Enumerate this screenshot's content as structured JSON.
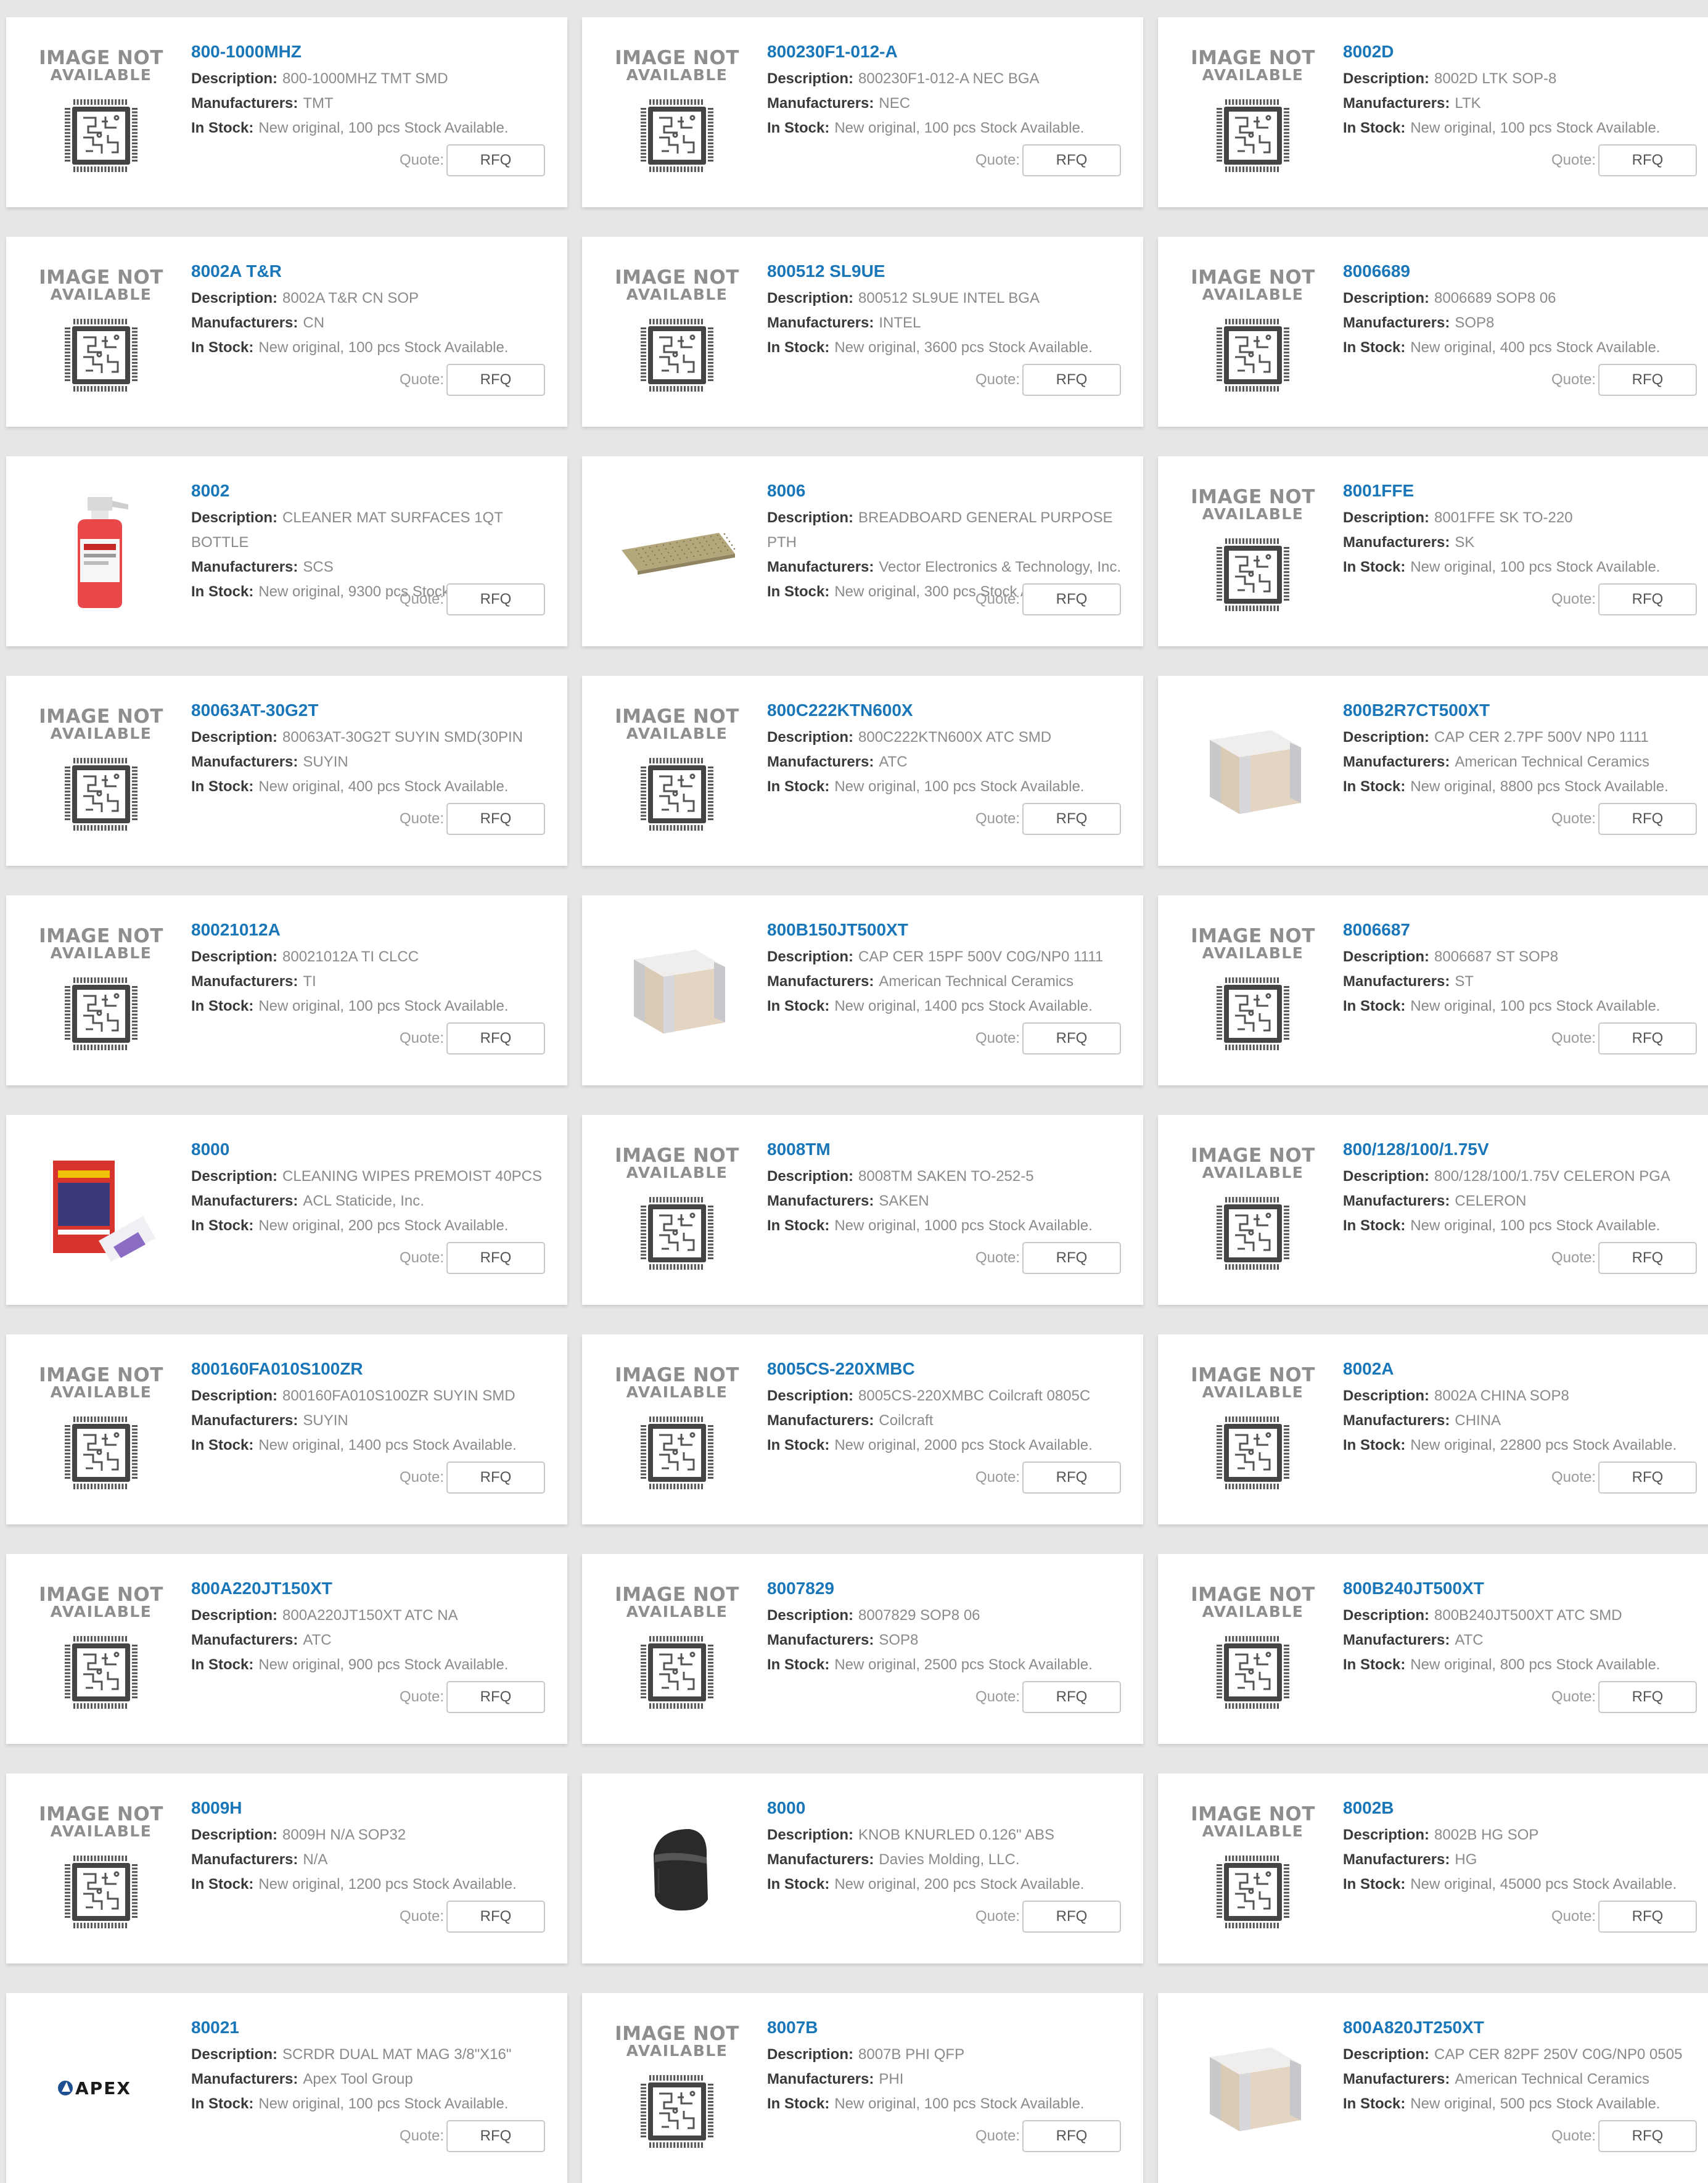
{
  "labels": {
    "description": "Description:",
    "manufacturers": "Manufacturers:",
    "in_stock": "In Stock:",
    "quote": "Quote:",
    "rfq": "RFQ",
    "image_na_line1": "IMAGE NOT",
    "image_na_line2": "AVAILABLE"
  },
  "colors": {
    "link": "#1976b8",
    "background": "#e6e6e6",
    "card": "#ffffff"
  },
  "products": [
    {
      "pn": "800-1000MHZ",
      "desc": "800-1000MHZ TMT SMD",
      "mfr": "TMT",
      "stock": "New original, 100 pcs Stock Available.",
      "image": "image-not-available"
    },
    {
      "pn": "800230F1-012-A",
      "desc": "800230F1-012-A NEC BGA",
      "mfr": "NEC",
      "stock": "New original, 100 pcs Stock Available.",
      "image": "image-not-available"
    },
    {
      "pn": "8002D",
      "desc": "8002D LTK SOP-8",
      "mfr": "LTK",
      "stock": "New original, 100 pcs Stock Available.",
      "image": "image-not-available"
    },
    {
      "pn": "8002A T&R",
      "desc": "8002A T&R CN SOP",
      "mfr": "CN",
      "stock": "New original, 100 pcs Stock Available.",
      "image": "image-not-available"
    },
    {
      "pn": "800512 SL9UE",
      "desc": "800512 SL9UE INTEL BGA",
      "mfr": "INTEL",
      "stock": "New original, 3600 pcs Stock Available.",
      "image": "image-not-available"
    },
    {
      "pn": "8006689",
      "desc": "8006689 SOP8 06",
      "mfr": "SOP8",
      "stock": "New original, 400 pcs Stock Available.",
      "image": "image-not-available"
    },
    {
      "pn": "8002",
      "desc": "CLEANER MAT SURFACES 1QT BOTTLE",
      "mfr": "SCS",
      "stock": "New original, 9300 pcs Stock Available.",
      "image": "spray-bottle-photo"
    },
    {
      "pn": "8006",
      "desc": "BREADBOARD GENERAL PURPOSE PTH",
      "mfr": "Vector Electronics & Technology, Inc.",
      "stock": "New original, 300 pcs Stock Available.",
      "image": "breadboard-photo"
    },
    {
      "pn": "8001FFE",
      "desc": "8001FFE SK TO-220",
      "mfr": "SK",
      "stock": "New original, 100 pcs Stock Available.",
      "image": "image-not-available"
    },
    {
      "pn": "80063AT-30G2T",
      "desc": "80063AT-30G2T SUYIN SMD(30PIN",
      "mfr": "SUYIN",
      "stock": "New original, 400 pcs Stock Available.",
      "image": "image-not-available"
    },
    {
      "pn": "800C222KTN600X",
      "desc": "800C222KTN600X ATC SMD",
      "mfr": "ATC",
      "stock": "New original, 100 pcs Stock Available.",
      "image": "image-not-available"
    },
    {
      "pn": "800B2R7CT500XT",
      "desc": "CAP CER 2.7PF 500V NP0 1111",
      "mfr": "American Technical Ceramics",
      "stock": "New original, 8800 pcs Stock Available.",
      "image": "capacitor-photo"
    },
    {
      "pn": "80021012A",
      "desc": "80021012A TI CLCC",
      "mfr": "TI",
      "stock": "New original, 100 pcs Stock Available.",
      "image": "image-not-available"
    },
    {
      "pn": "800B150JT500XT",
      "desc": "CAP CER 15PF 500V C0G/NP0 1111",
      "mfr": "American Technical Ceramics",
      "stock": "New original, 1400 pcs Stock Available.",
      "image": "capacitor-photo"
    },
    {
      "pn": "8006687",
      "desc": "8006687 ST SOP8",
      "mfr": "ST",
      "stock": "New original, 100 pcs Stock Available.",
      "image": "image-not-available"
    },
    {
      "pn": "8000",
      "desc": "CLEANING WIPES PREMOIST 40PCS",
      "mfr": "ACL Staticide, Inc.",
      "stock": "New original, 200 pcs Stock Available.",
      "image": "wipes-package-photo"
    },
    {
      "pn": "8008TM",
      "desc": "8008TM SAKEN TO-252-5",
      "mfr": "SAKEN",
      "stock": "New original, 1000 pcs Stock Available.",
      "image": "image-not-available"
    },
    {
      "pn": "800/128/100/1.75V",
      "desc": "800/128/100/1.75V CELERON PGA",
      "mfr": "CELERON",
      "stock": "New original, 100 pcs Stock Available.",
      "image": "image-not-available"
    },
    {
      "pn": "800160FA010S100ZR",
      "desc": "800160FA010S100ZR SUYIN SMD",
      "mfr": "SUYIN",
      "stock": "New original, 1400 pcs Stock Available.",
      "image": "image-not-available"
    },
    {
      "pn": "8005CS-220XMBC",
      "desc": "8005CS-220XMBC Coilcraft 0805C",
      "mfr": "Coilcraft",
      "stock": "New original, 2000 pcs Stock Available.",
      "image": "image-not-available"
    },
    {
      "pn": "8002A",
      "desc": "8002A CHINA SOP8",
      "mfr": "CHINA",
      "stock": "New original, 22800 pcs Stock Available.",
      "image": "image-not-available"
    },
    {
      "pn": "800A220JT150XT",
      "desc": "800A220JT150XT ATC NA",
      "mfr": "ATC",
      "stock": "New original, 900 pcs Stock Available.",
      "image": "image-not-available"
    },
    {
      "pn": "8007829",
      "desc": "8007829 SOP8 06",
      "mfr": "SOP8",
      "stock": "New original, 2500 pcs Stock Available.",
      "image": "image-not-available"
    },
    {
      "pn": "800B240JT500XT",
      "desc": "800B240JT500XT ATC SMD",
      "mfr": "ATC",
      "stock": "New original, 800 pcs Stock Available.",
      "image": "image-not-available"
    },
    {
      "pn": "8009H",
      "desc": "8009H N/A SOP32",
      "mfr": "N/A",
      "stock": "New original, 1200 pcs Stock Available.",
      "image": "image-not-available"
    },
    {
      "pn": "8000",
      "desc": "KNOB KNURLED 0.126\" ABS",
      "mfr": "Davies Molding, LLC.",
      "stock": "New original, 200 pcs Stock Available.",
      "image": "knob-photo"
    },
    {
      "pn": "8002B",
      "desc": "8002B HG SOP",
      "mfr": "HG",
      "stock": "New original, 45000 pcs Stock Available.",
      "image": "image-not-available"
    },
    {
      "pn": "80021",
      "desc": "SCRDR DUAL MAT MAG 3/8\"X16\"",
      "mfr": "Apex Tool Group",
      "stock": "New original, 100 pcs Stock Available.",
      "image": "apex-logo"
    },
    {
      "pn": "8007B",
      "desc": "8007B PHI QFP",
      "mfr": "PHI",
      "stock": "New original, 100 pcs Stock Available.",
      "image": "image-not-available"
    },
    {
      "pn": "800A820JT250XT",
      "desc": "CAP CER 82PF 250V C0G/NP0 0505",
      "mfr": "American Technical Ceramics",
      "stock": "New original, 500 pcs Stock Available.",
      "image": "capacitor-photo"
    }
  ]
}
